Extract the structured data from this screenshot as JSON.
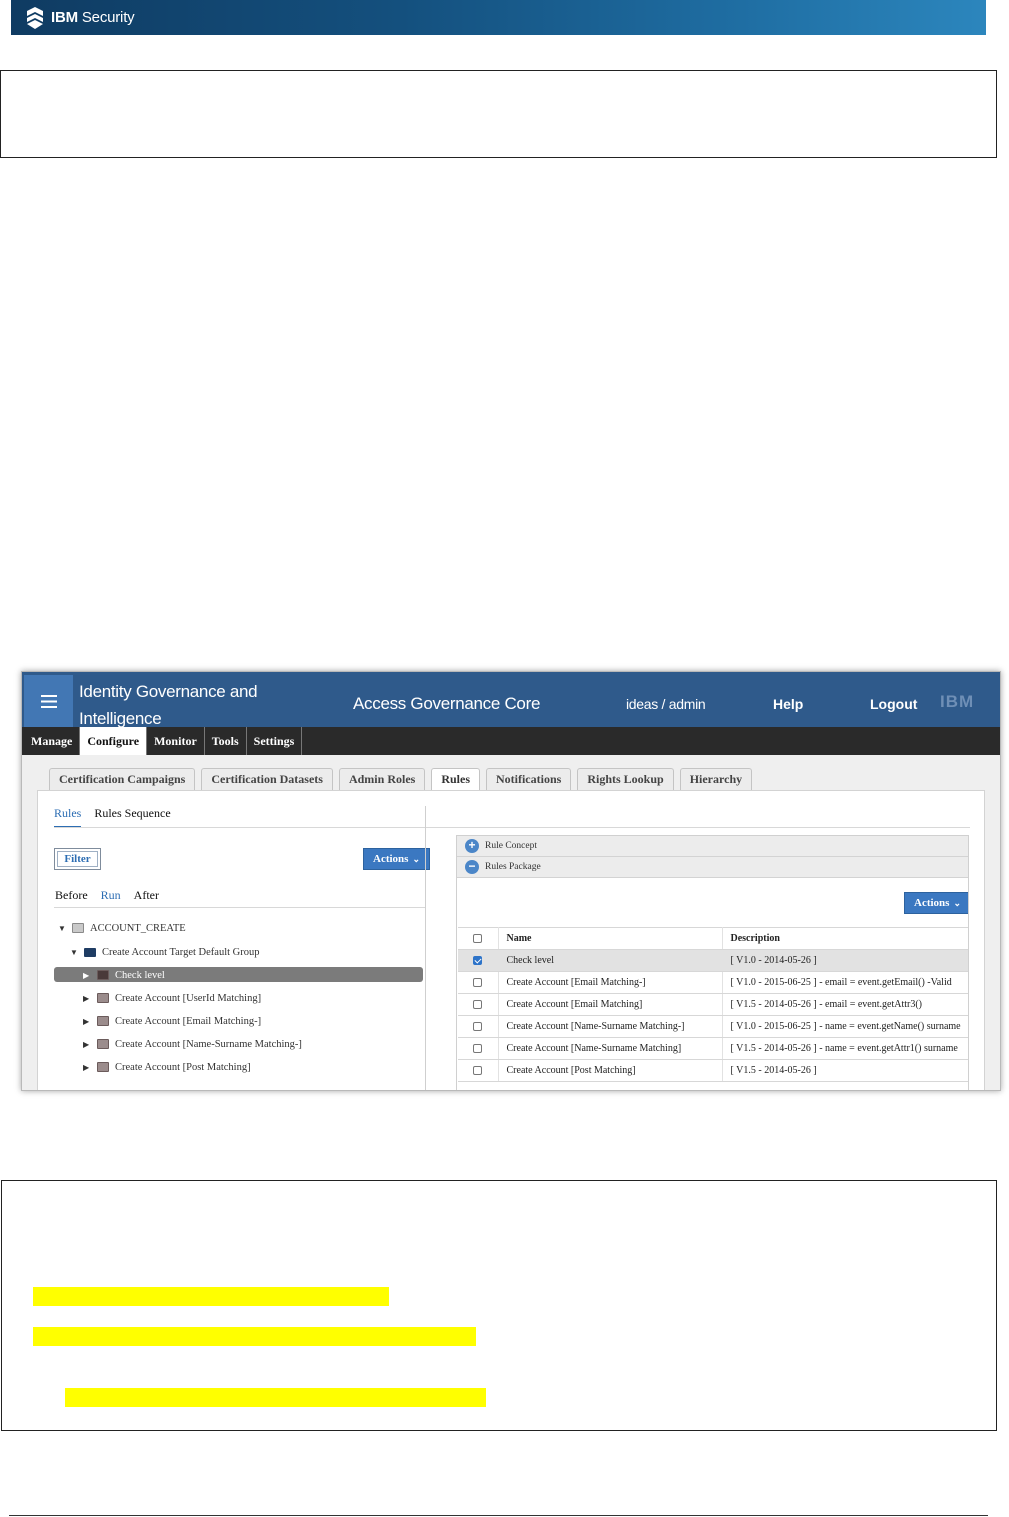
{
  "document": {
    "brand": {
      "bold": "IBM",
      "rest": " Security",
      "icon": "ibm-security-shield-icon"
    },
    "highlights": [
      "",
      "",
      ""
    ]
  },
  "app": {
    "title": "Identity Governance and Intelligence",
    "module": "Access Governance Core",
    "user": "ideas / admin",
    "help": "Help",
    "logout": "Logout",
    "logo": "IBM",
    "nav": [
      "Manage",
      "Configure",
      "Monitor",
      "Tools",
      "Settings"
    ],
    "nav_active": "Configure",
    "subtabs": [
      "Certification Campaigns",
      "Certification Datasets",
      "Admin Roles",
      "Rules",
      "Notifications",
      "Rights Lookup",
      "Hierarchy"
    ],
    "subtab_active": "Rules",
    "rules_tabs": [
      "Rules",
      "Rules Sequence"
    ],
    "filter_label": "Filter",
    "actions_label": "Actions",
    "phase_tabs": [
      "Before",
      "Run",
      "After"
    ],
    "tree": [
      {
        "label": "ACCOUNT_CREATE",
        "icon": "calendar-icon"
      },
      {
        "label": "Create Account Target Default Group",
        "icon": "folder-icon"
      },
      {
        "label": "Check level",
        "icon": "rule-icon",
        "selected": true
      },
      {
        "label": "Create Account [UserId Matching]",
        "icon": "rule-icon"
      },
      {
        "label": "Create Account [Email Matching-]",
        "icon": "rule-icon"
      },
      {
        "label": "Create Account [Name-Surname Matching-]",
        "icon": "rule-icon"
      },
      {
        "label": "Create Account [Post Matching]",
        "icon": "rule-icon"
      }
    ],
    "accordion": [
      {
        "label": "Rule Concept",
        "icon": "plus-circle-icon"
      },
      {
        "label": "Rules Package",
        "icon": "minus-circle-icon"
      }
    ],
    "table": {
      "headers": [
        "Name",
        "Description"
      ],
      "rows": [
        {
          "name": "Check level",
          "desc": "[ V1.0 - 2014-05-26 ]",
          "checked": true
        },
        {
          "name": "Create Account [Email Matching-]",
          "desc": "[ V1.0 - 2015-06-25 ] - email = event.getEmail() -Valid",
          "checked": false
        },
        {
          "name": "Create Account [Email Matching]",
          "desc": "[ V1.5 - 2014-05-26 ] - email = event.getAttr3()",
          "checked": false
        },
        {
          "name": "Create Account [Name-Surname Matching-]",
          "desc": "[ V1.0 - 2015-06-25 ] - name = event.getName() surname",
          "checked": false
        },
        {
          "name": "Create Account [Name-Surname Matching]",
          "desc": "[ V1.5 - 2014-05-26 ] - name = event.getAttr1() surname",
          "checked": false
        },
        {
          "name": "Create Account [Post Matching]",
          "desc": "[ V1.5 - 2014-05-26 ]",
          "checked": false
        }
      ]
    }
  }
}
